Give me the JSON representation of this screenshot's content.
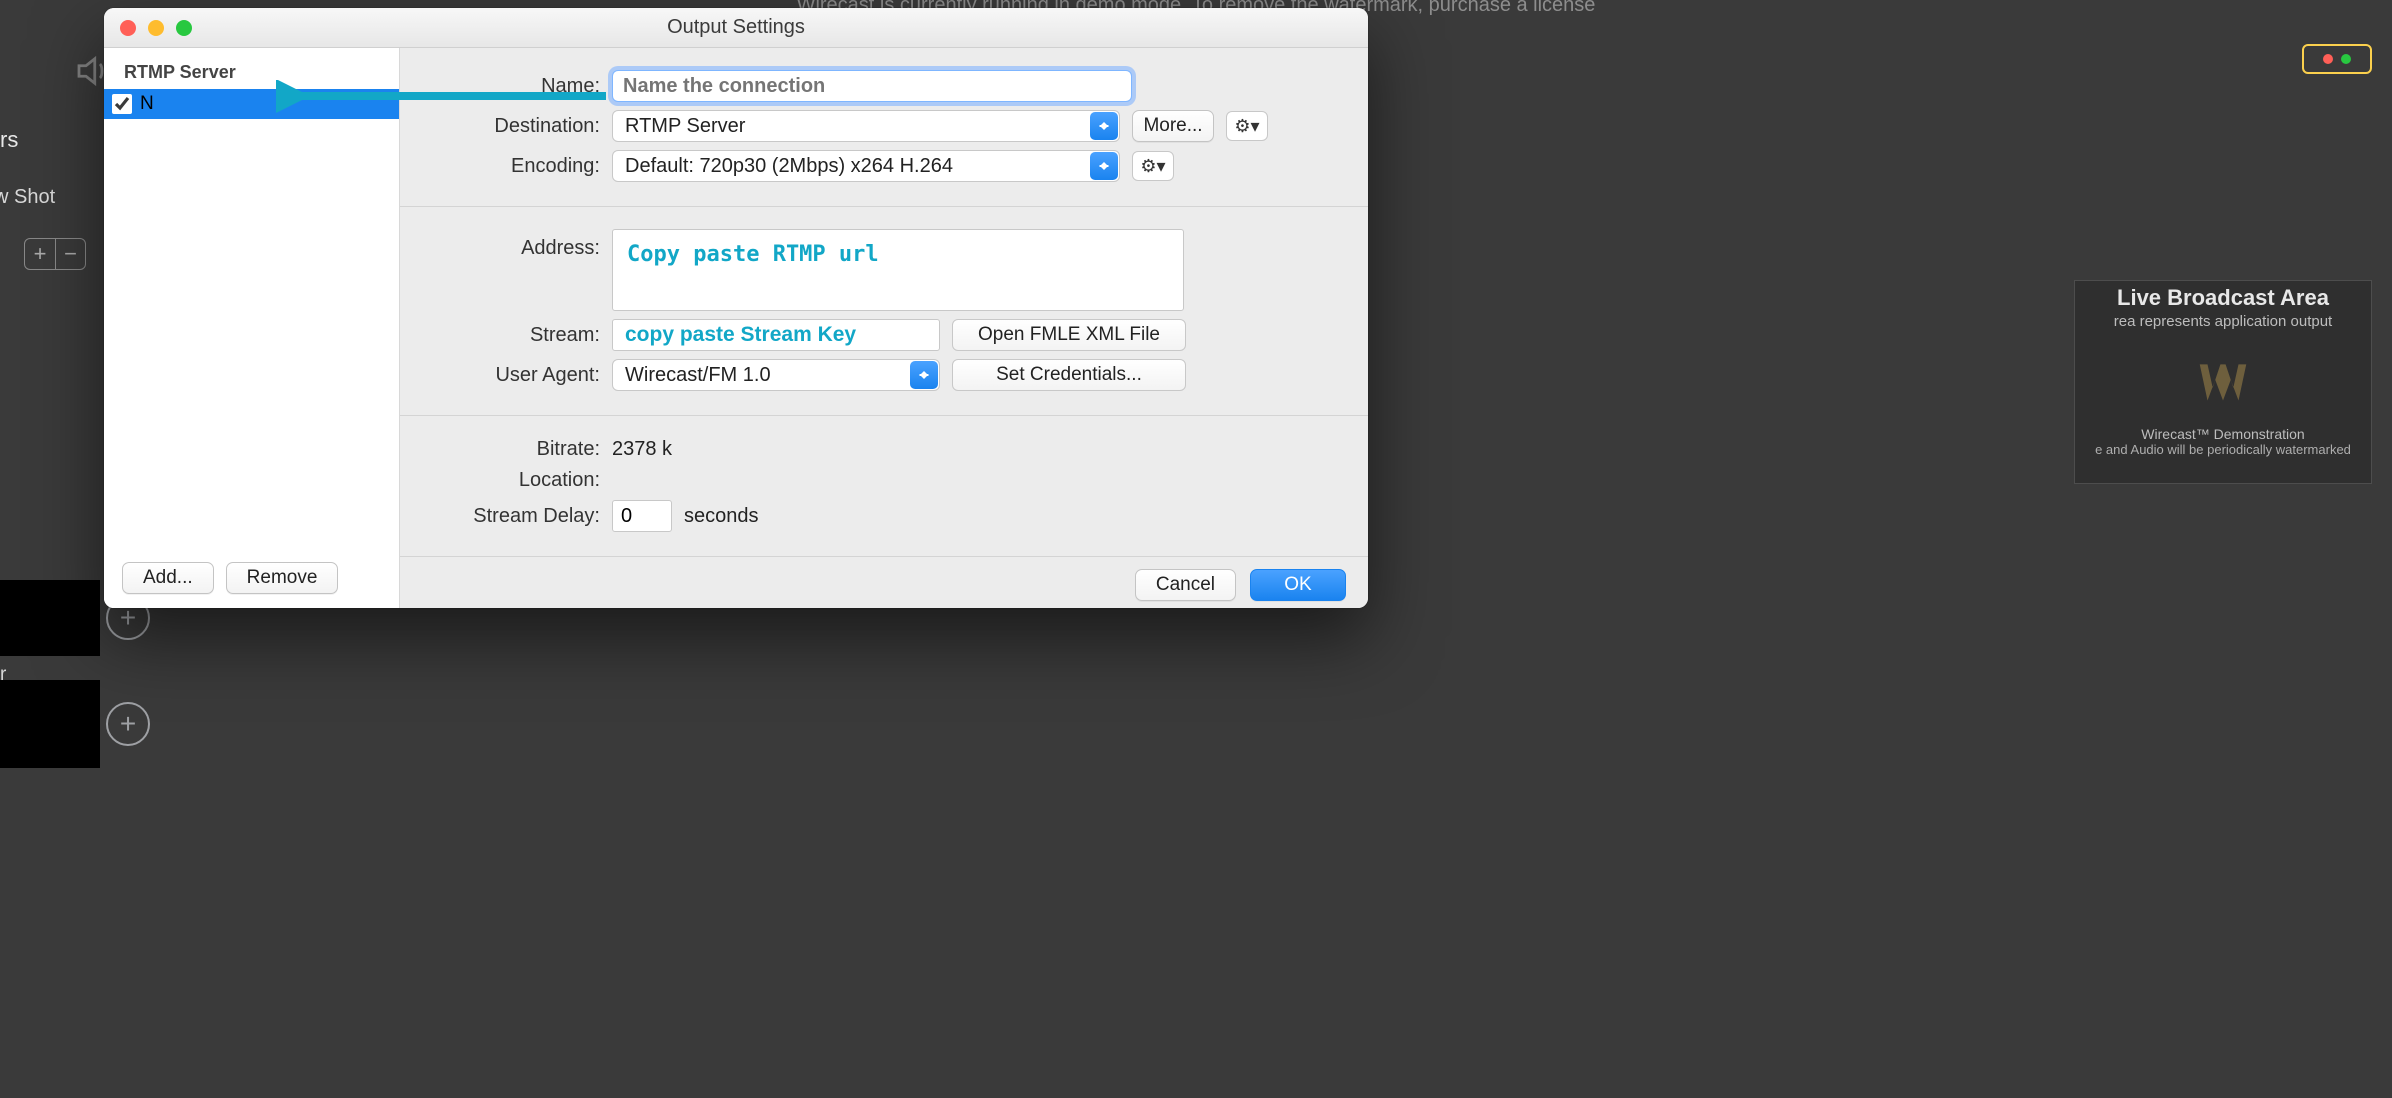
{
  "banner": "Wirecast is currently running in demo mode. To remove the watermark,   purchase a license",
  "main_window": {
    "left_label1": "rs",
    "left_label2": "w Shot",
    "thumb_label": "r",
    "broadcast": {
      "title": "Live Broadcast Area",
      "subtitle": "rea represents application output",
      "caption1": "Wirecast™ Demonstration",
      "caption2": "e and Audio will be periodically watermarked"
    }
  },
  "dialog": {
    "title": "Output Settings",
    "sidebar": {
      "heading": "RTMP Server",
      "item": {
        "checked": true,
        "label": "N"
      },
      "add": "Add...",
      "remove": "Remove"
    },
    "fields": {
      "name_label": "Name:",
      "name_placeholder": "Name the connection",
      "destination_label": "Destination:",
      "destination_value": "RTMP Server",
      "more": "More...",
      "encoding_label": "Encoding:",
      "encoding_value": "Default: 720p30 (2Mbps) x264 H.264",
      "address_label": "Address:",
      "address_placeholder": "Copy paste RTMP url",
      "stream_label": "Stream:",
      "stream_placeholder": "copy paste Stream Key",
      "open_fmle": "Open FMLE XML File",
      "user_agent_label": "User Agent:",
      "user_agent_value": "Wirecast/FM 1.0",
      "set_credentials": "Set Credentials...",
      "bitrate_label": "Bitrate:",
      "bitrate_value": "2378 k",
      "location_label": "Location:",
      "delay_label": "Stream Delay:",
      "delay_value": "0",
      "delay_unit": "seconds"
    },
    "footer": {
      "cancel": "Cancel",
      "ok": "OK"
    }
  }
}
